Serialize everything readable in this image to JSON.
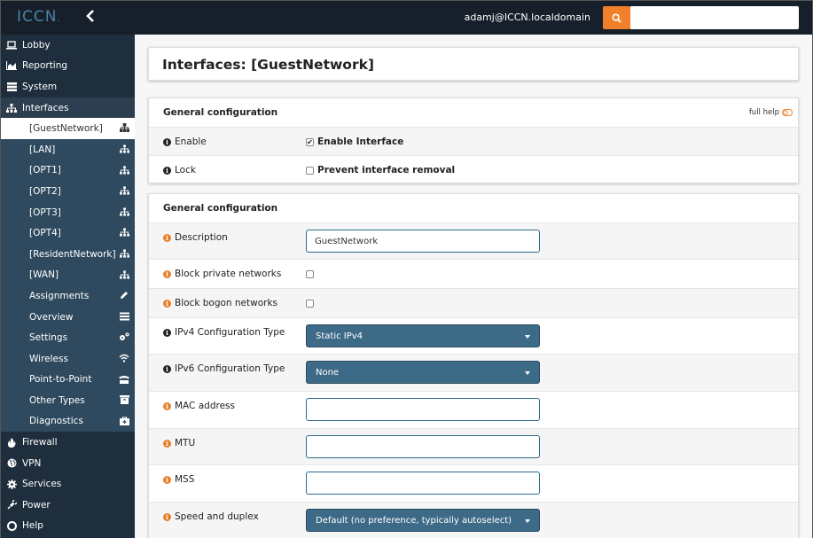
{
  "header": {
    "logo": "ICCN",
    "logo_dot": ".",
    "user": "adamj@ICCN.localdomain",
    "search_placeholder": ""
  },
  "colors": {
    "topbar": "#17202a",
    "sidebar": "#1e2e3c",
    "accent": "#f0812a",
    "select": "#3d6a86"
  },
  "sidebar": {
    "top_items_a": [
      {
        "label": "Lobby",
        "icon": "laptop-icon"
      },
      {
        "label": "Reporting",
        "icon": "area-chart-icon"
      },
      {
        "label": "System",
        "icon": "server-icon"
      },
      {
        "label": "Interfaces",
        "icon": "sitemap-icon"
      }
    ],
    "sub_items": [
      {
        "label": "[GuestNetwork]",
        "icon": "sitemap-icon",
        "selected": true
      },
      {
        "label": "[LAN]",
        "icon": "sitemap-icon"
      },
      {
        "label": "[OPT1]",
        "icon": "sitemap-icon"
      },
      {
        "label": "[OPT2]",
        "icon": "sitemap-icon"
      },
      {
        "label": "[OPT3]",
        "icon": "sitemap-icon"
      },
      {
        "label": "[OPT4]",
        "icon": "sitemap-icon"
      },
      {
        "label": "[ResidentNetwork]",
        "icon": "sitemap-icon"
      },
      {
        "label": "[WAN]",
        "icon": "sitemap-icon"
      },
      {
        "label": "Assignments",
        "icon": "pencil-icon"
      },
      {
        "label": "Overview",
        "icon": "tasks-icon"
      },
      {
        "label": "Settings",
        "icon": "cogs-icon"
      },
      {
        "label": "Wireless",
        "icon": "wifi-icon"
      },
      {
        "label": "Point-to-Point",
        "icon": "tty-icon"
      },
      {
        "label": "Other Types",
        "icon": "archive-icon"
      },
      {
        "label": "Diagnostics",
        "icon": "medkit-icon"
      }
    ],
    "top_items_b": [
      {
        "label": "Firewall",
        "icon": "fire-icon"
      },
      {
        "label": "VPN",
        "icon": "globe-icon"
      },
      {
        "label": "Services",
        "icon": "cog-icon"
      },
      {
        "label": "Power",
        "icon": "plug-icon"
      },
      {
        "label": "Help",
        "icon": "life-ring-icon"
      }
    ]
  },
  "page": {
    "title": "Interfaces: [GuestNetwork]"
  },
  "panel1": {
    "heading": "General configuration",
    "full_help": "full help",
    "rows": [
      {
        "label": "Enable",
        "checked": true,
        "check_label": "Enable Interface"
      },
      {
        "label": "Lock",
        "checked": false,
        "check_label": "Prevent interface removal"
      }
    ]
  },
  "panel2": {
    "heading": "General configuration",
    "description_label": "Description",
    "description_value": "GuestNetwork",
    "block_private_label": "Block private networks",
    "block_bogon_label": "Block bogon networks",
    "ipv4_label": "IPv4 Configuration Type",
    "ipv4_value": "Static IPv4",
    "ipv6_label": "IPv6 Configuration Type",
    "ipv6_value": "None",
    "mac_label": "MAC address",
    "mac_value": "",
    "mtu_label": "MTU",
    "mtu_value": "",
    "mss_label": "MSS",
    "mss_value": "",
    "speed_label": "Speed and duplex",
    "speed_value": "Default (no preference, typically autoselect)"
  }
}
